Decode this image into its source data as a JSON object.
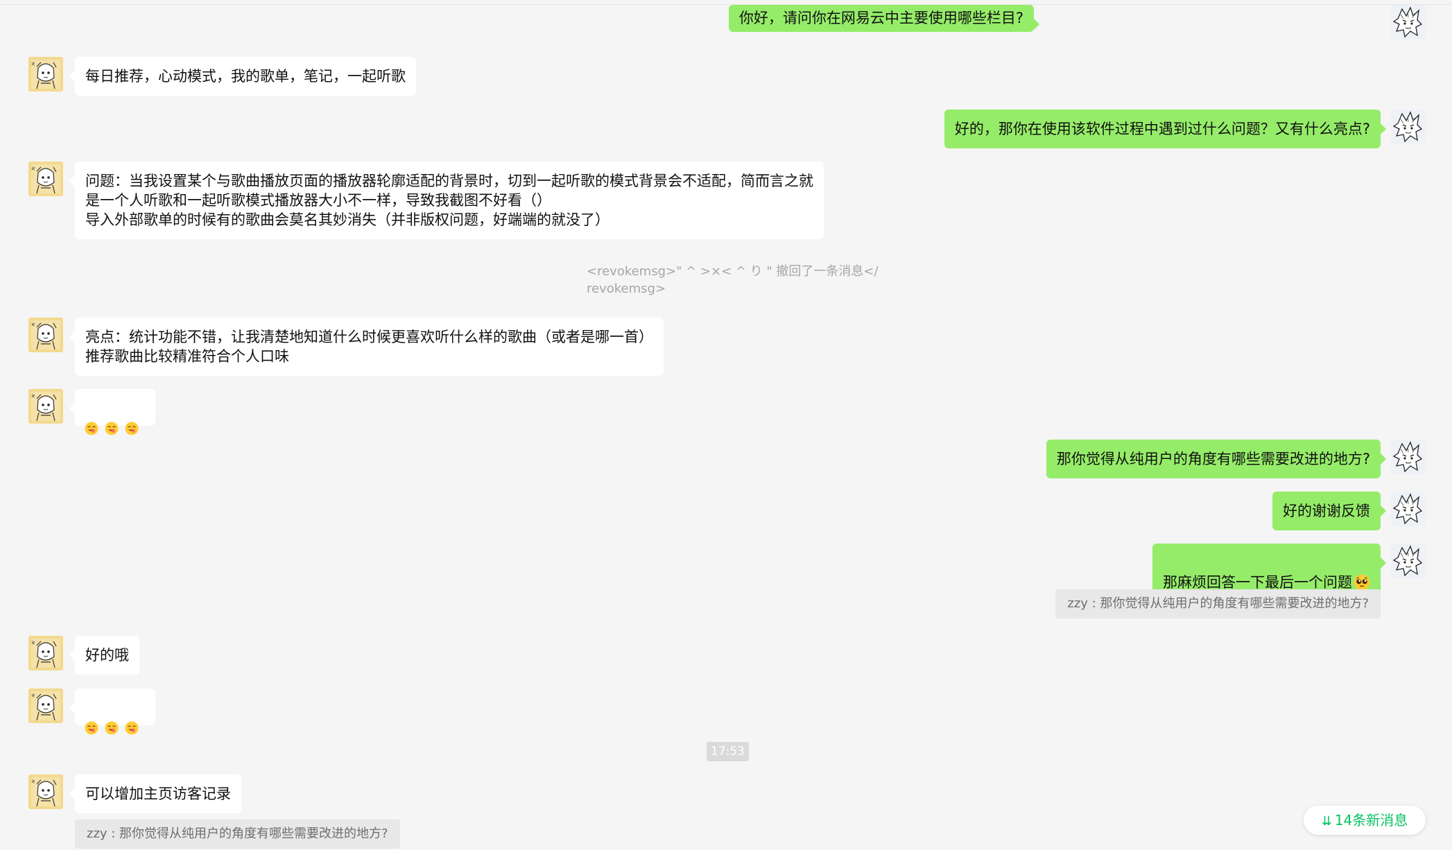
{
  "messages": {
    "m1_text": "你好，请问你在网易云中主要使用哪些栏目?",
    "m2_text": "每日推荐，心动模式，我的歌单，笔记，一起听歌",
    "m3_text": "好的，那你在使用该软件过程中遇到过什么问题？又有什么亮点?",
    "m4_text": "问题：当我设置某个与歌曲播放页面的播放器轮廓适配的背景时，切到一起听歌的模式背景会不适配，简而言之就\n是一个人听歌和一起听歌模式播放器大小不一样，导致我截图不好看（）\n导入外部歌单的时候有的歌曲会莫名其妙消失（并非版权问题，好端端的就没了）",
    "m5_sys": "<revokemsg>\" ^ >×< ^ り \" 撤回了一条消息</\nrevokemsg>",
    "m6_text": "亮点：统计功能不错，让我清楚地知道什么时候更喜欢听什么样的歌曲（或者是哪一首）\n推荐歌曲比较精准符合个人口味",
    "m8_text": "那你觉得从纯用户的角度有哪些需要改进的地方?",
    "m9_text": "好的谢谢反馈",
    "m10_text": "那麻烦回答一下最后一个问题",
    "m10_quote": "zzy : 那你觉得从纯用户的角度有哪些需要改进的地方?",
    "m11_text": "好的哦",
    "timestamp": "17:53",
    "m13_text": "可以增加主页访客记录",
    "m13_quote": "zzy : 那你觉得从纯用户的角度有哪些需要改进的地方?"
  },
  "new_messages_button": {
    "label": "14条新消息",
    "icon": "double-chevron-down-icon"
  },
  "colors": {
    "background": "#f5f5f5",
    "bubble_self": "#95ec69",
    "bubble_other": "#ffffff",
    "accent_green": "#07c160"
  }
}
